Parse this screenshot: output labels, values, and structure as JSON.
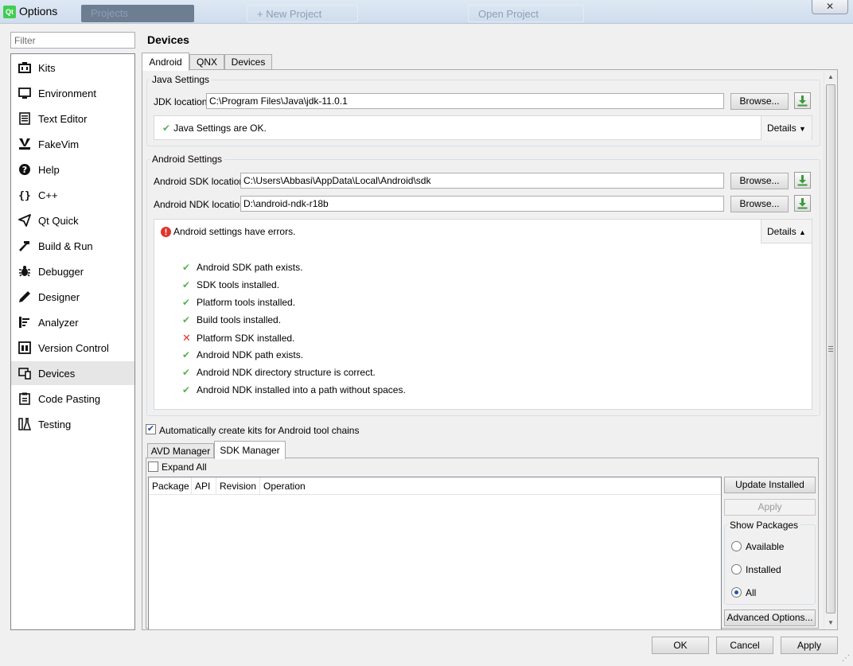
{
  "window": {
    "title": "Options",
    "app_icon_text": "Qt",
    "close_glyph": "✕",
    "background_items": [
      "Projects",
      "+ New Project",
      "Open Project"
    ]
  },
  "sidebar": {
    "filter_placeholder": "Filter",
    "items": [
      {
        "label": "Kits",
        "icon": "kits-icon"
      },
      {
        "label": "Environment",
        "icon": "monitor-icon"
      },
      {
        "label": "Text Editor",
        "icon": "text-editor-icon"
      },
      {
        "label": "FakeVim",
        "icon": "fakevim-icon"
      },
      {
        "label": "Help",
        "icon": "help-icon"
      },
      {
        "label": "C++",
        "icon": "braces-icon"
      },
      {
        "label": "Qt Quick",
        "icon": "paper-plane-icon"
      },
      {
        "label": "Build & Run",
        "icon": "hammer-icon"
      },
      {
        "label": "Debugger",
        "icon": "bug-icon"
      },
      {
        "label": "Designer",
        "icon": "pencil-icon"
      },
      {
        "label": "Analyzer",
        "icon": "analyzer-icon"
      },
      {
        "label": "Version Control",
        "icon": "version-control-icon"
      },
      {
        "label": "Devices",
        "icon": "devices-icon"
      },
      {
        "label": "Code Pasting",
        "icon": "clipboard-icon"
      },
      {
        "label": "Testing",
        "icon": "flask-icon"
      }
    ],
    "selected": "Devices"
  },
  "page": {
    "title": "Devices",
    "tabs": [
      "Android",
      "QNX",
      "Devices"
    ],
    "active_tab": "Android"
  },
  "java": {
    "group_title": "Java Settings",
    "jdk_label": "JDK location:",
    "jdk_value": "C:\\Program Files\\Java\\jdk-11.0.1",
    "browse_label": "Browse...",
    "status_text": "Java Settings are OK.",
    "details_label": "Details"
  },
  "android": {
    "group_title": "Android Settings",
    "sdk_label": "Android SDK location:",
    "sdk_value": "C:\\Users\\Abbasi\\AppData\\Local\\Android\\sdk",
    "ndk_label": "Android NDK location:",
    "ndk_value": "D:\\android-ndk-r18b",
    "browse_label": "Browse...",
    "status_text": "Android settings have errors.",
    "details_label": "Details",
    "checks": [
      {
        "text": "Android SDK path exists.",
        "ok": true
      },
      {
        "text": "SDK tools installed.",
        "ok": true
      },
      {
        "text": "Platform tools installed.",
        "ok": true
      },
      {
        "text": "Build tools installed.",
        "ok": true
      },
      {
        "text": "Platform SDK installed.",
        "ok": false
      },
      {
        "text": "Android NDK path exists.",
        "ok": true
      },
      {
        "text": "Android NDK directory structure is correct.",
        "ok": true
      },
      {
        "text": "Android NDK installed into a path without spaces.",
        "ok": true
      }
    ]
  },
  "auto_kits": {
    "label": "Automatically create kits for Android tool chains",
    "checked": true
  },
  "manager": {
    "tabs": [
      "AVD Manager",
      "SDK Manager"
    ],
    "active_tab": "SDK Manager",
    "expand_all_label": "Expand All",
    "columns": [
      "Package",
      "API",
      "Revision",
      "Operation"
    ],
    "update_installed_label": "Update Installed",
    "apply_label": "Apply",
    "show_packages_title": "Show Packages",
    "show_options": [
      "Available",
      "Installed",
      "All"
    ],
    "show_selected": "All",
    "advanced_label": "Advanced Options..."
  },
  "dialog": {
    "ok_label": "OK",
    "cancel_label": "Cancel",
    "apply_label": "Apply"
  },
  "colors": {
    "check": "#58b354",
    "error": "#e2342c",
    "selection": "#e6e6e6",
    "download_arrow": "#3a9a3a"
  }
}
